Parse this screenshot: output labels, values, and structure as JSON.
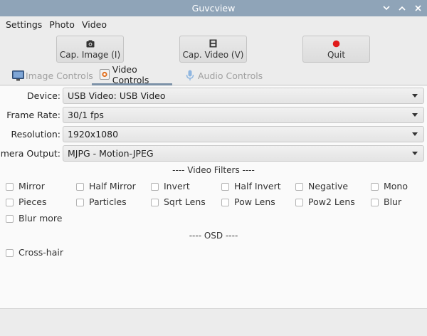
{
  "window": {
    "title": "Guvcview"
  },
  "menu": {
    "items": [
      "Settings",
      "Photo",
      "Video"
    ]
  },
  "toolbar": {
    "cap_image": "Cap. Image (I)",
    "cap_video": "Cap. Video (V)",
    "quit": "Quit",
    "quit_color": "#e01b1b"
  },
  "tabs": [
    {
      "label": "Image Controls",
      "icon": "monitor-icon",
      "active": false
    },
    {
      "label": "Video Controls",
      "icon": "video-controls-icon",
      "active": true
    },
    {
      "label": "Audio Controls",
      "icon": "microphone-icon",
      "active": false
    }
  ],
  "video": {
    "device_label": "Device:",
    "device_value": "USB Video: USB Video",
    "frame_rate_label": "Frame Rate:",
    "frame_rate_value": "30/1 fps",
    "resolution_label": "Resolution:",
    "resolution_value": "1920x1080",
    "camera_output_label": "Camera Output:",
    "camera_output_value": "MJPG - Motion-JPEG"
  },
  "filters": {
    "title": "---- Video Filters ----",
    "items": [
      "Mirror",
      "Half Mirror",
      "Invert",
      "Half Invert",
      "Negative",
      "Mono",
      "Pieces",
      "Particles",
      "Sqrt Lens",
      "Pow Lens",
      "Pow2 Lens",
      "Blur",
      "Blur more"
    ]
  },
  "osd": {
    "title": "---- OSD ----",
    "items": [
      "Cross-hair"
    ]
  },
  "colors": {
    "titlebar": "#8fa4b8",
    "tab_underline": "#7d92a8"
  }
}
